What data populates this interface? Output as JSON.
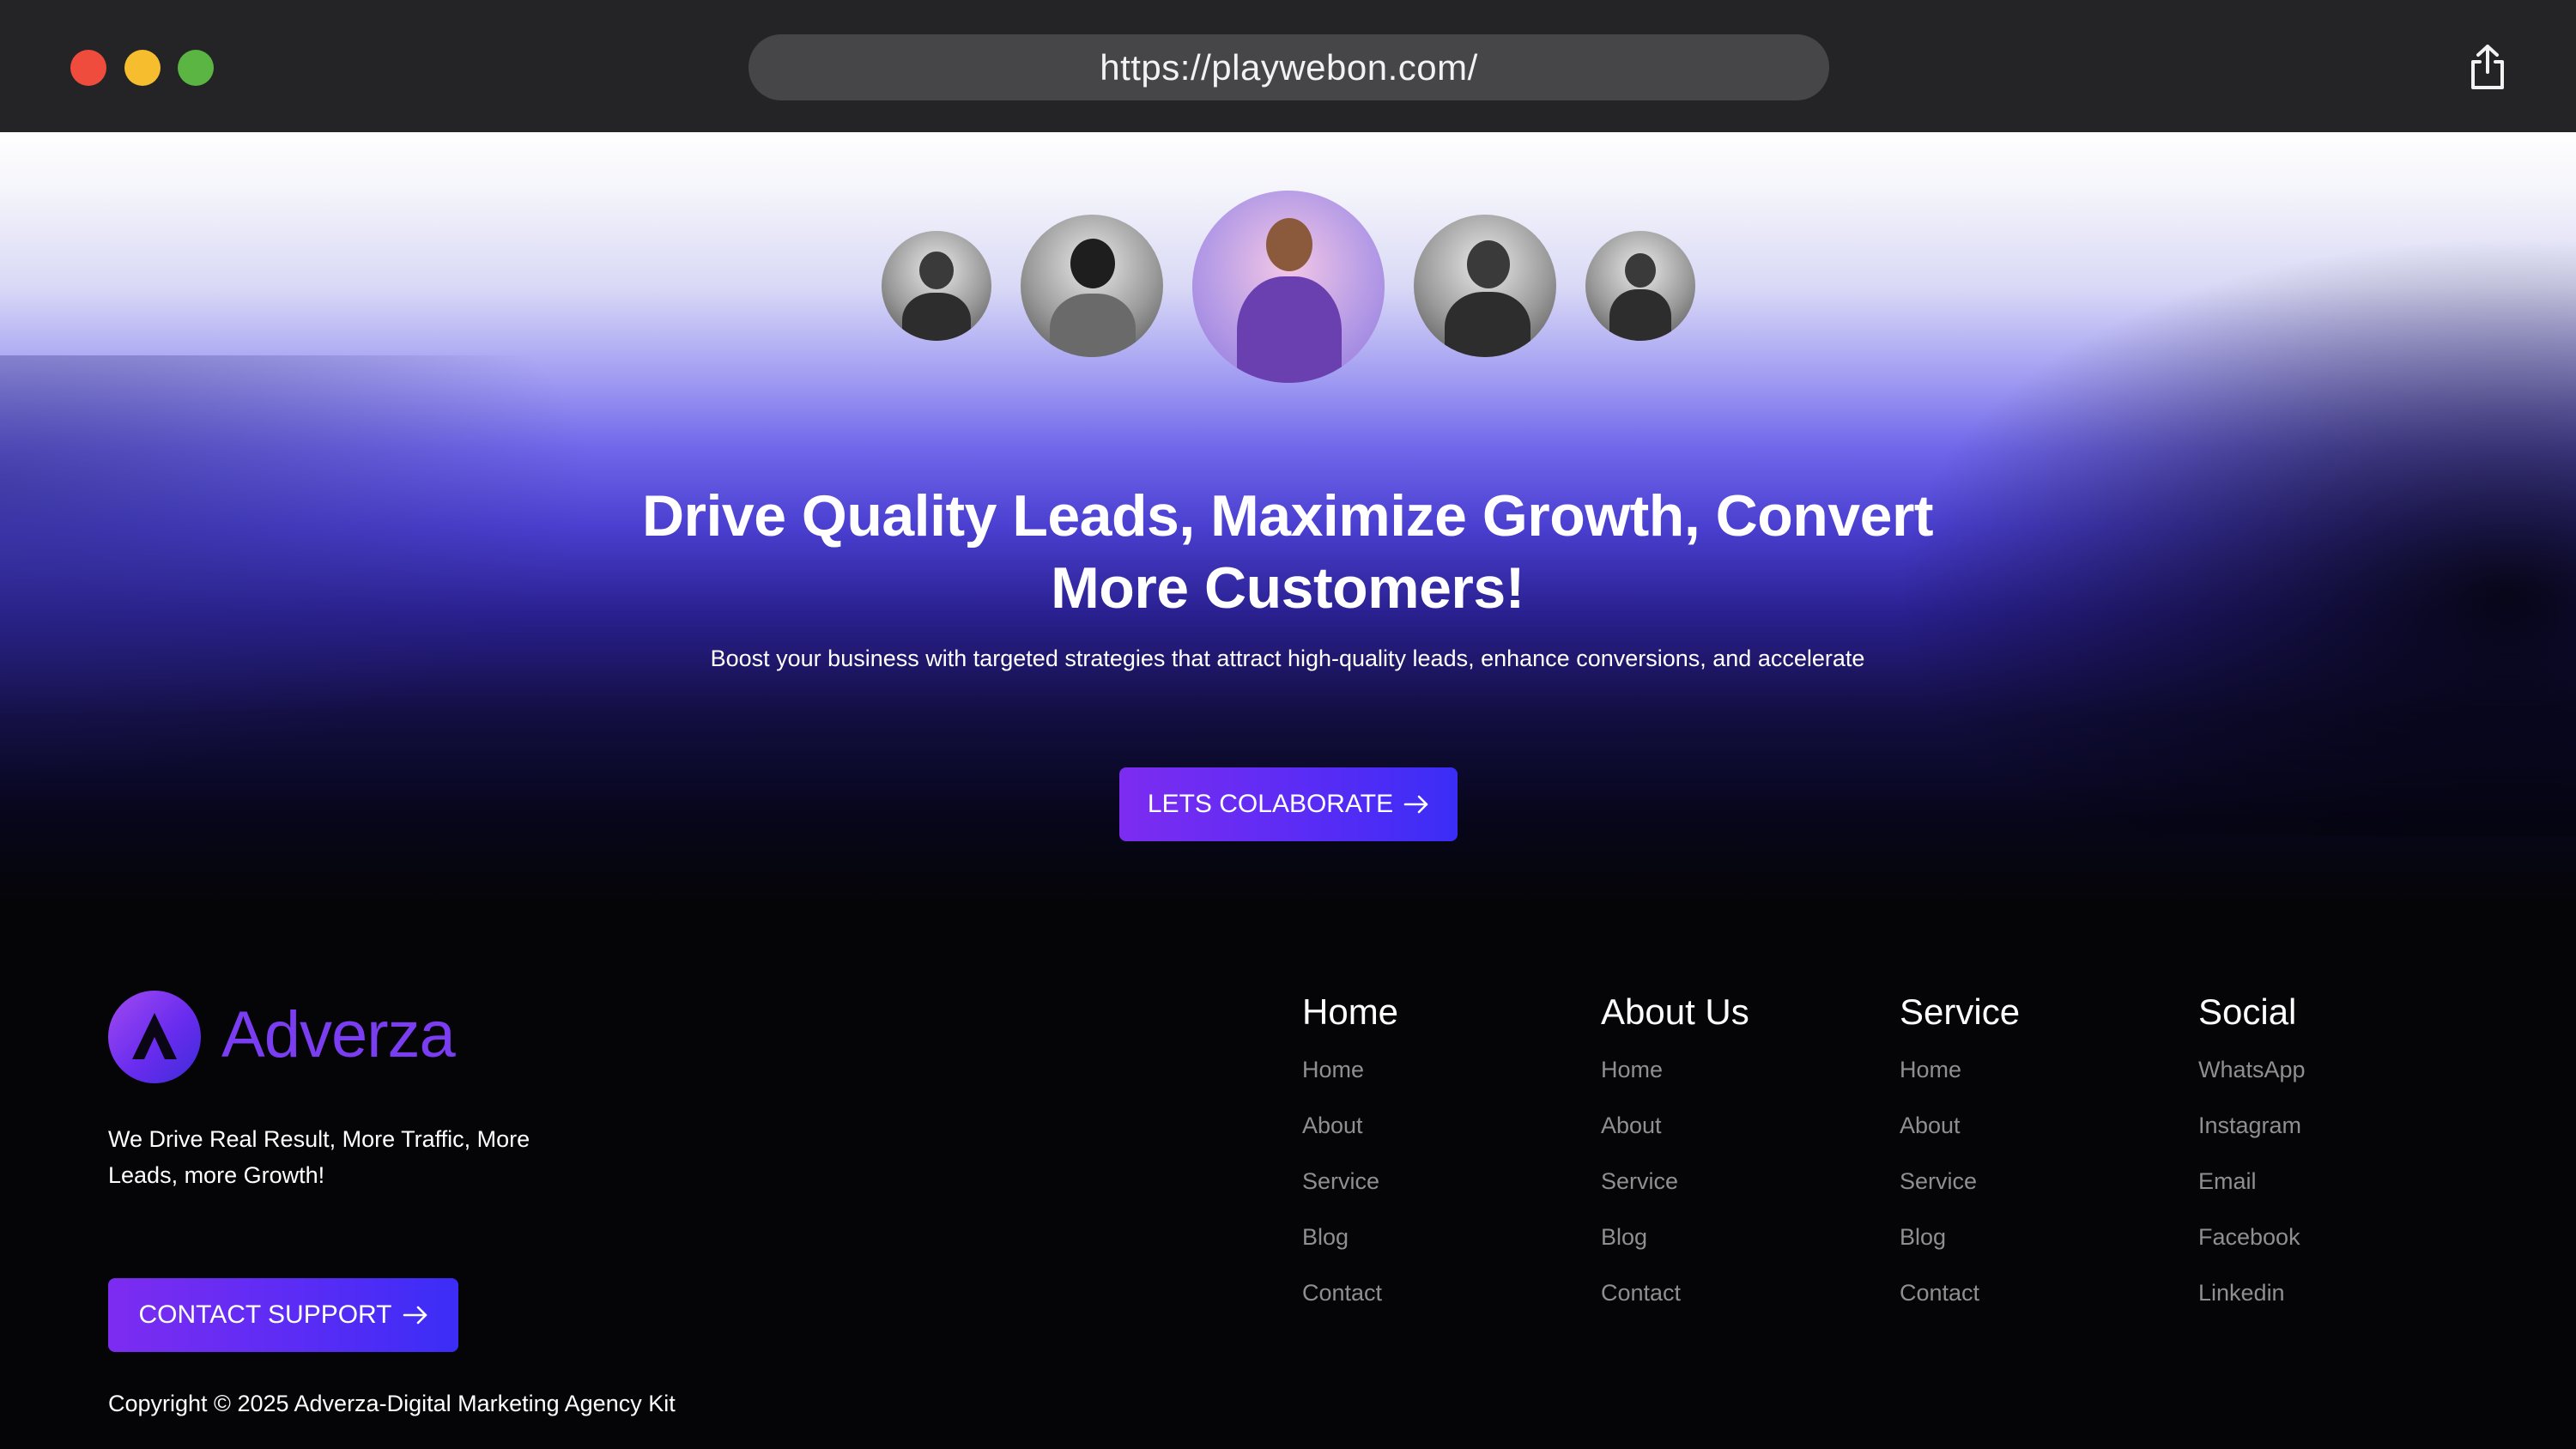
{
  "browser": {
    "url": "https://playwebon.com/"
  },
  "hero": {
    "title": "Drive Quality Leads, Maximize Growth, Convert More Customers!",
    "subtitle": "Boost your business with targeted strategies that attract high-quality leads, enhance conversions, and accelerate",
    "cta_label": "LETS COLABORATE"
  },
  "brand": {
    "name": "Adverza",
    "tagline": "We Drive Real Result, More Traffic, More Leads, more Growth!",
    "support_label": "CONTACT SUPPORT",
    "copyright": "Copyright © 2025 Adverza-Digital Marketing Agency Kit",
    "accent": "#7b3df2"
  },
  "footer": {
    "columns": [
      {
        "heading": "Home",
        "links": [
          "Home",
          "About",
          "Service",
          "Blog",
          "Contact"
        ]
      },
      {
        "heading": "About Us",
        "links": [
          "Home",
          "About",
          "Service",
          "Blog",
          "Contact"
        ]
      },
      {
        "heading": "Service",
        "links": [
          "Home",
          "About",
          "Service",
          "Blog",
          "Contact"
        ]
      },
      {
        "heading": "Social",
        "links": [
          "WhatsApp",
          "Instagram",
          "Email",
          "Facebook",
          "Linkedin"
        ]
      }
    ]
  }
}
